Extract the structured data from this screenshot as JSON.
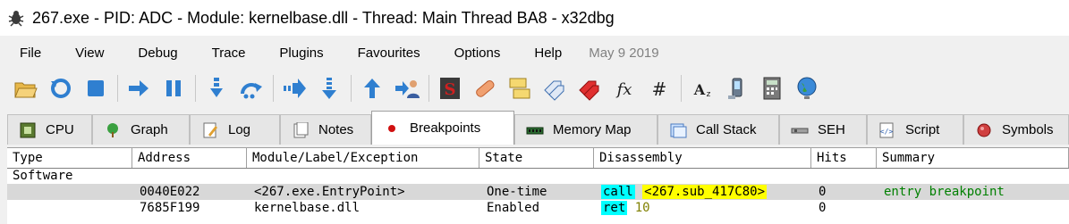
{
  "window": {
    "title": "267.exe - PID: ADC - Module: kernelbase.dll - Thread: Main Thread BA8 - x32dbg"
  },
  "menu": {
    "items": [
      "File",
      "View",
      "Debug",
      "Trace",
      "Plugins",
      "Favourites",
      "Options",
      "Help"
    ],
    "date": "May 9 2019"
  },
  "toolbar": {
    "buttons": [
      "open-icon",
      "restart-icon",
      "stop-icon",
      "run-icon",
      "pause-icon",
      "step-into-icon",
      "step-over-icon",
      "trace-into-icon",
      "trace-over-icon",
      "execute-till-return-icon",
      "run-to-user-code-icon",
      "scylla-icon",
      "patch-icon",
      "comments-icon",
      "labels-icon",
      "bookmarks-icon",
      "functions-icon",
      "variables-icon",
      "strings-icon",
      "calls-icon",
      "calculator-icon",
      "globe-icon"
    ]
  },
  "tabs": [
    {
      "label": "CPU"
    },
    {
      "label": "Graph"
    },
    {
      "label": "Log"
    },
    {
      "label": "Notes"
    },
    {
      "label": "Breakpoints"
    },
    {
      "label": "Memory Map"
    },
    {
      "label": "Call Stack"
    },
    {
      "label": "SEH"
    },
    {
      "label": "Script"
    },
    {
      "label": "Symbols"
    }
  ],
  "table": {
    "headers": [
      "Type",
      "Address",
      "Module/Label/Exception",
      "State",
      "Disassembly",
      "Hits",
      "Summary"
    ],
    "group": "Software",
    "rows": [
      {
        "address": "0040E022",
        "module": "<267.exe.EntryPoint>",
        "state": "One-time",
        "dis_op": "call",
        "dis_arg": "<267.sub_417C80>",
        "hits": "0",
        "summary": "entry breakpoint"
      },
      {
        "address": "7685F199",
        "module": "kernelbase.dll",
        "state": "Enabled",
        "dis_op": "ret",
        "dis_arg": "10",
        "hits": "0",
        "summary": ""
      }
    ]
  },
  "colors": {
    "highlight_cyan": "#00ffff",
    "highlight_yellow": "#ffff00",
    "summary_green": "#008000",
    "selected_row": "#d8d8d8"
  }
}
